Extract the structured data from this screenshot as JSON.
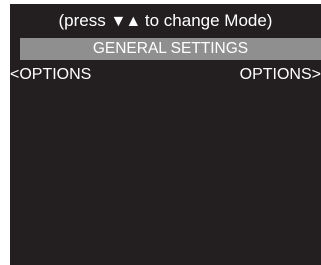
{
  "hint": {
    "prefix": "(press ",
    "arrows": "▼▲",
    "suffix": " to change Mode)"
  },
  "title": "GENERAL SETTINGS",
  "options": {
    "left_label": "<OPTIONS",
    "right_label": "OPTIONS>"
  },
  "colors": {
    "screen_bg": "#231f20",
    "title_bar_bg": "#8f8f8f",
    "text": "#ffffff"
  }
}
